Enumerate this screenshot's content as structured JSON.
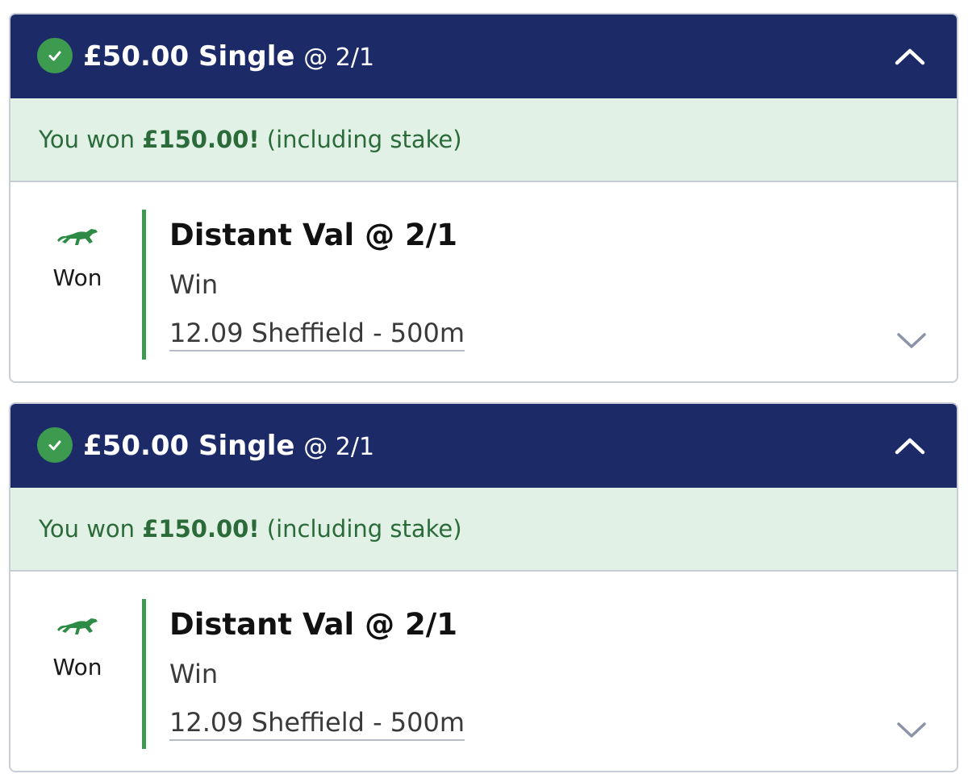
{
  "bets": [
    {
      "header": {
        "stake_label": "£50.00 Single",
        "odds_label": "@ 2/1",
        "status_icon": "check-circle-icon",
        "toggle_icon": "chevron-up-icon"
      },
      "result": {
        "prefix": "You won",
        "amount": "£150.00!",
        "suffix": "(including stake)"
      },
      "selection": {
        "sport_icon": "greyhound-icon",
        "status": "Won",
        "name": "Distant Val @ 2/1",
        "market": "Win",
        "event": "12.09 Sheffield - 500m",
        "toggle_icon": "chevron-down-icon"
      }
    },
    {
      "header": {
        "stake_label": "£50.00 Single",
        "odds_label": "@ 2/1",
        "status_icon": "check-circle-icon",
        "toggle_icon": "chevron-up-icon"
      },
      "result": {
        "prefix": "You won",
        "amount": "£150.00!",
        "suffix": "(including stake)"
      },
      "selection": {
        "sport_icon": "greyhound-icon",
        "status": "Won",
        "name": "Distant Val @ 2/1",
        "market": "Win",
        "event": "12.09 Sheffield - 500m",
        "toggle_icon": "chevron-down-icon"
      }
    }
  ],
  "colors": {
    "header_bg": "#1c2b68",
    "win_green": "#3d9b4f",
    "banner_bg": "#e2f1e6",
    "banner_text": "#2b6b3a"
  }
}
